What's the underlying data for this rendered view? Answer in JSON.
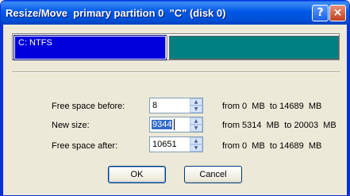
{
  "window": {
    "title": "Resize/Move  primary partition 0  \"C\" (disk 0)",
    "help_label": "?",
    "close_label": "×"
  },
  "partition_map": {
    "partition_label": "C: NTFS"
  },
  "fields": [
    {
      "label": "Free space before:",
      "value": "8",
      "range": "from 0  MB  to 14689  MB"
    },
    {
      "label": "New size:",
      "value": "9344",
      "range": "from 5314  MB  to 20003  MB"
    },
    {
      "label": "Free space after:",
      "value": "10651",
      "range": "from 0  MB  to 14689  MB"
    }
  ],
  "spin_glyphs": {
    "up": "▲",
    "down": "▼"
  },
  "buttons": {
    "ok": "OK",
    "cancel": "Cancel"
  },
  "colors": {
    "titlebar": "#0058e6",
    "partition": "#0000dd",
    "free_space": "#008080"
  }
}
